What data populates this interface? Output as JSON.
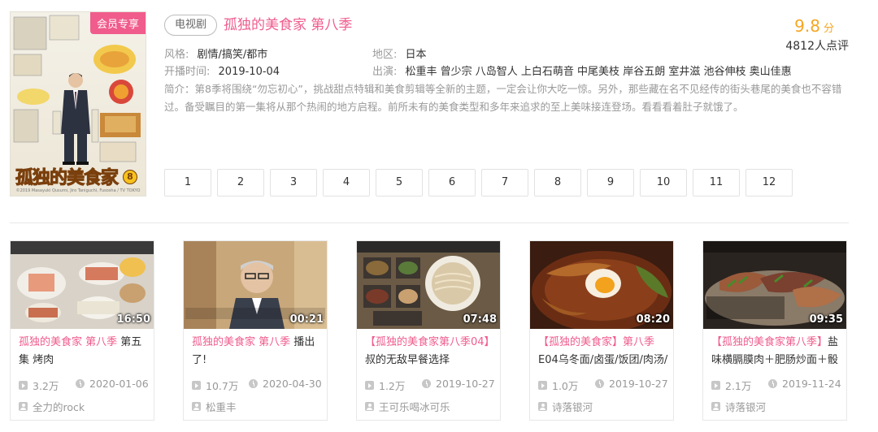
{
  "poster": {
    "vip_badge": "会员专享",
    "logo_text": "孤独的美食家",
    "logo_number": "8",
    "copyright": "©2019 Masayuki Qusumi, Jiro Taniguchi, Fusosha / TV TOKYO"
  },
  "show": {
    "tag": "电视剧",
    "title": "孤独的美食家 第八季",
    "score": "9.8",
    "score_unit": "分",
    "votes": "4812人点评",
    "genre_label": "风格:",
    "genre": "剧情/搞笑/都市",
    "region_label": "地区:",
    "region": "日本",
    "date_label": "开播时间:",
    "date": "2019-10-04",
    "cast_label": "出演:",
    "cast": "松重丰 曾少宗 八岛智人 上白石萌音 中尾美枝 岸谷五朗 室井滋 池谷伸枝 奥山佳惠",
    "desc": "简介：第8季将围绕“勿忘初心”，挑战甜点特辑和美食剪辑等全新的主题，一定会让你大吃一惊。另外，那些藏在名不见经传的街头巷尾的美食也不容错过。备受瞩目的第一集将从那个热闹的地方启程。前所未有的美食类型和多年来追求的至上美味接连登场。看看看着肚子就饿了。"
  },
  "episodes": [
    "1",
    "2",
    "3",
    "4",
    "5",
    "6",
    "7",
    "8",
    "9",
    "10",
    "11",
    "12"
  ],
  "videos": [
    {
      "title_pink": "孤独的美食家 第八季 ",
      "title_rest": "第五集 烤肉",
      "duration": "16:50",
      "views": "3.2万",
      "date": "2020-01-06",
      "author": "全力的rock"
    },
    {
      "title_pink": "孤独的美食家 第八季 ",
      "title_rest": "播出了!",
      "duration": "00:21",
      "views": "10.7万",
      "date": "2020-04-30",
      "author": "松重丰"
    },
    {
      "title_pink": "【孤独的美食家第八季04】",
      "title_rest": "叔的无敌早餐选择",
      "duration": "07:48",
      "views": "1.2万",
      "date": "2019-10-27",
      "author": "王可乐喝冰可乐"
    },
    {
      "title_pink": "【孤独的美食家】第八季",
      "title_rest": "E04乌冬面/卤蛋/饭团/肉汤/",
      "duration": "08:20",
      "views": "1.0万",
      "date": "2019-10-27",
      "author": "诗落银河"
    },
    {
      "title_pink": "【孤独的美食家第八季】",
      "title_rest": "盐味横膈膜肉＋肥肠炒面＋骰",
      "duration": "09:35",
      "views": "2.1万",
      "date": "2019-11-24",
      "author": "诗落银河"
    }
  ],
  "colors": {
    "accent": "#f05c8c",
    "score": "#f5a623",
    "muted": "#999999"
  }
}
